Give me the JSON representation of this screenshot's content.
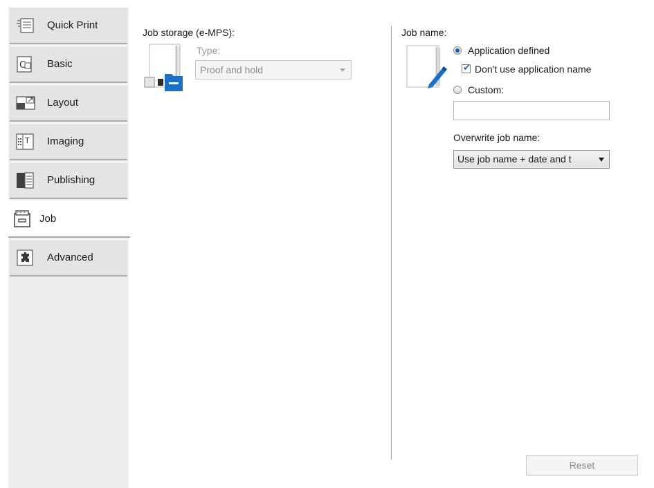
{
  "sidebar": {
    "tabs": [
      {
        "label": "Quick Print",
        "icon": "quick-print-icon",
        "active": false
      },
      {
        "label": "Basic",
        "icon": "basic-icon",
        "active": false
      },
      {
        "label": "Layout",
        "icon": "layout-icon",
        "active": false
      },
      {
        "label": "Imaging",
        "icon": "imaging-icon",
        "active": false
      },
      {
        "label": "Publishing",
        "icon": "publishing-icon",
        "active": false
      },
      {
        "label": "Job",
        "icon": "job-icon",
        "active": true
      },
      {
        "label": "Advanced",
        "icon": "advanced-icon",
        "active": false
      }
    ]
  },
  "job_storage": {
    "label": "Job storage (e-MPS):",
    "type_label": "Type:",
    "type_value": "Proof and hold",
    "enabled": false
  },
  "job_name": {
    "label": "Job name:",
    "application_defined_label": "Application defined",
    "application_defined_selected": true,
    "dont_use_app_name_label": "Don't use application name",
    "dont_use_app_name_checked": true,
    "custom_label": "Custom:",
    "custom_selected": false,
    "custom_value": "",
    "overwrite_label": "Overwrite job name:",
    "overwrite_value": "Use job name + date and t"
  },
  "footer": {
    "reset_label": "Reset"
  },
  "colors": {
    "accent": "#1c5fb5",
    "folder_blue": "#1b6fc4"
  }
}
